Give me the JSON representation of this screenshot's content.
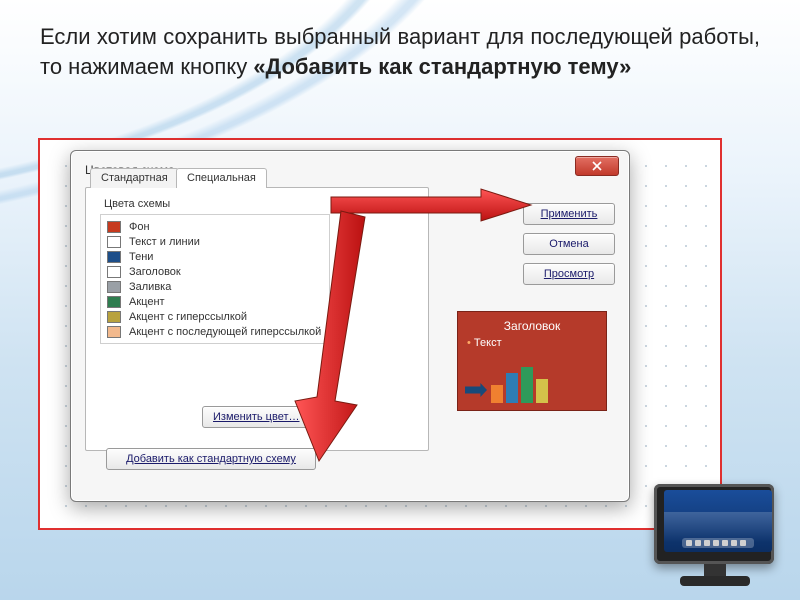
{
  "caption": {
    "pre": "Если хотим сохранить выбранный вариант для последующей работы, то нажимаем кнопку ",
    "bold": "«Добавить как стандартную тему»"
  },
  "dialog": {
    "title": "Цветовая схема",
    "tabs": {
      "standard": "Стандартная",
      "custom": "Специальная"
    },
    "group_label": "Цвета схемы",
    "items": [
      {
        "label": "Фон",
        "color": "#c63a1f"
      },
      {
        "label": "Текст и линии",
        "color": "#ffffff"
      },
      {
        "label": "Тени",
        "color": "#1d4e89"
      },
      {
        "label": "Заголовок",
        "color": "#ffffff"
      },
      {
        "label": "Заливка",
        "color": "#9aa0a6"
      },
      {
        "label": "Акцент",
        "color": "#2e7d4f"
      },
      {
        "label": "Акцент с гиперссылкой",
        "color": "#b8a23d"
      },
      {
        "label": "Акцент с последующей гиперссылкой",
        "color": "#f2b98d"
      }
    ],
    "buttons": {
      "change_color": "Изменить цвет…",
      "add_scheme": "Добавить как стандартную схему",
      "apply": "Применить",
      "cancel": "Отмена",
      "preview": "Просмотр"
    },
    "preview": {
      "title": "Заголовок",
      "text": "Текст"
    }
  }
}
